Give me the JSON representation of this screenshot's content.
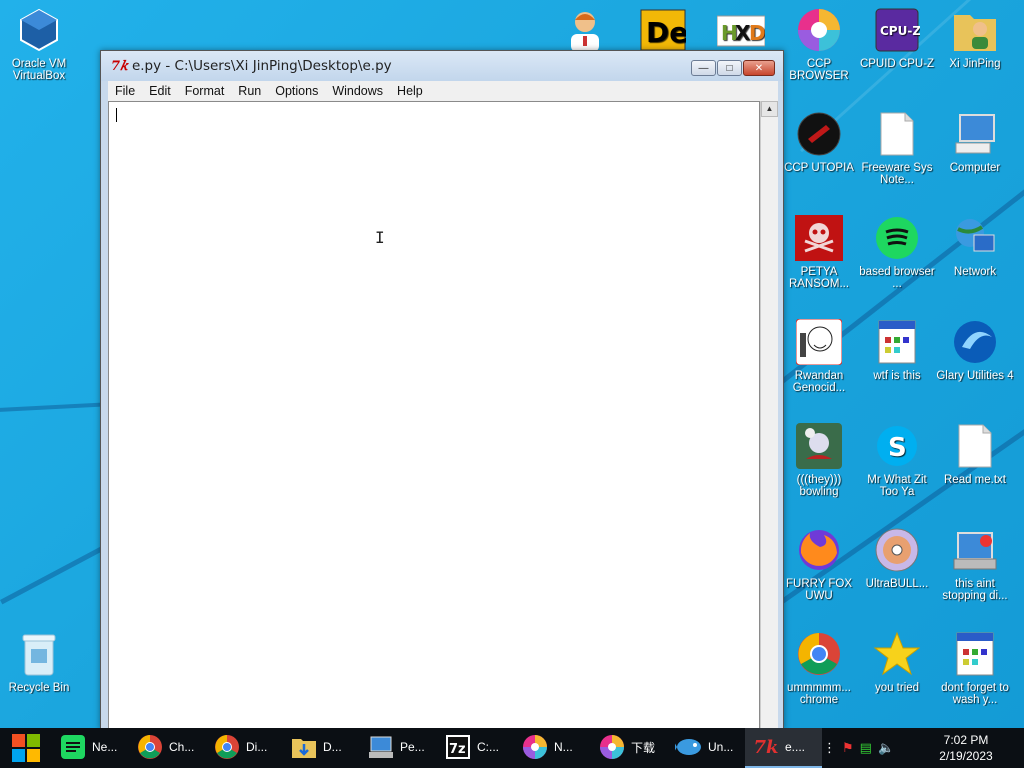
{
  "window": {
    "title": "e.py - C:\\Users\\Xi JinPing\\Desktop\\e.py",
    "menu": [
      "File",
      "Edit",
      "Format",
      "Run",
      "Options",
      "Windows",
      "Help"
    ],
    "editor_text": ""
  },
  "desktop_icons": {
    "virtualbox": "Oracle VM VirtualBox",
    "recycle_bin": "Recycle Bin",
    "ccp_browser": "CCP BROWSER",
    "cpuz": "CPUID CPU-Z",
    "xijinping": "Xi JinPing",
    "ccp_utopia": "CCP UTOPIA",
    "freeware": "Freeware Sys Note...",
    "computer": "Computer",
    "petya": "PETYA RANSOM...",
    "based_browser": "based browser ...",
    "network": "Network",
    "rwandan": "Rwandan Genocid...",
    "wtf": "wtf is this",
    "glary": "Glary Utilities 4",
    "bowling": "(((they))) bowling",
    "skype": "Mr What Zit Too Ya",
    "readme": "Read me.txt",
    "firefox": "FURRY FOX UWU",
    "ultrabull": "UltraBULL...",
    "notstopping": "this aint stopping di...",
    "chrome": "ummmmm... chrome",
    "youtried": "you tried",
    "dontforget": "dont forget to wash y..."
  },
  "taskbar": {
    "items": [
      "Ne...",
      "Ch...",
      "Di...",
      "D...",
      "Pe...",
      "C:...",
      "N...",
      "下载",
      "Un...",
      "e...."
    ],
    "time": "7:02 PM",
    "date": "2/19/2023"
  },
  "colors": {
    "desktop_bg": "#1ca9e0",
    "taskbar_bg": "#0b0f14",
    "close_red": "#c7452c"
  }
}
